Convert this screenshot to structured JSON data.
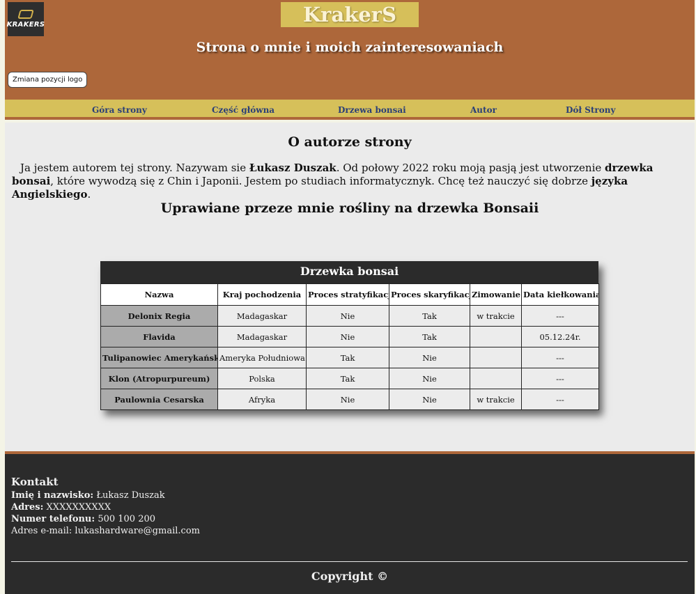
{
  "header": {
    "logo_text": "KRAKERS",
    "brand": "KrakerS",
    "tagline": "Strona o mnie i moich zainteresowaniach",
    "move_logo_button": "Zmiana pozycji logo"
  },
  "nav": {
    "items": [
      {
        "label": "Góra strony"
      },
      {
        "label": "Część główna"
      },
      {
        "label": "Drzewa bonsai"
      },
      {
        "label": "Autor"
      },
      {
        "label": "Dół Strony"
      }
    ]
  },
  "about": {
    "title": "O autorze strony",
    "text_1": "Ja jestem autorem tej strony. Nazywam sie ",
    "name": "Łukasz Duszak",
    "text_2": ". Od połowy 2022 roku moją pasją jest utworzenie ",
    "bonsai": "drzewka bonsai",
    "text_3": ", które wywodzą się z Chin i Japonii. Jestem po studiach informatycznyk. Chcę też nauczyć się dobrze ",
    "english": "języka Angielskiego",
    "text_4": "."
  },
  "plants": {
    "title": "Uprawiane przeze mnie rośliny na drzewka Bonsaii",
    "table_caption": "Drzewka bonsai",
    "columns": [
      "Nazwa",
      "Kraj pochodzenia",
      "Proces stratyfikacji",
      "Proces skaryfikacji",
      "Zimowanie",
      "Data kiełkowania"
    ],
    "rows": [
      [
        "Delonix Regia",
        "Madagaskar",
        "Nie",
        "Tak",
        "w trakcie",
        "---"
      ],
      [
        "Flavida",
        "Madagaskar",
        "Nie",
        "Tak",
        "",
        "05.12.24r."
      ],
      [
        "Tulipanowiec Amerykański",
        "Ameryka Południowa",
        "Tak",
        "Nie",
        "",
        "---"
      ],
      [
        "Klon (Atropurpureum)",
        "Polska",
        "Tak",
        "Nie",
        "",
        "---"
      ],
      [
        "Paulownia Cesarska",
        "Afryka",
        "Nie",
        "Nie",
        "w trakcie",
        "---"
      ]
    ]
  },
  "footer": {
    "contact_heading": "Kontakt",
    "name_label": "Imię i nazwisko:",
    "name_value": " Łukasz Duszak",
    "address_label": "Adres:",
    "address_value": " XXXXXXXXXX",
    "phone_label": "Numer telefonu:",
    "phone_value": " 500 100 200",
    "email_line": "Adres e-mail: lukashardware@gmail.com",
    "copyright": "Copyright ©"
  },
  "colors": {
    "header_bg": "#ad673a",
    "nav_bg": "#d6c05a",
    "brand_bg": "#d6bf5a",
    "footer_bg": "#2b2b2b",
    "nav_link": "#2a3f78"
  }
}
